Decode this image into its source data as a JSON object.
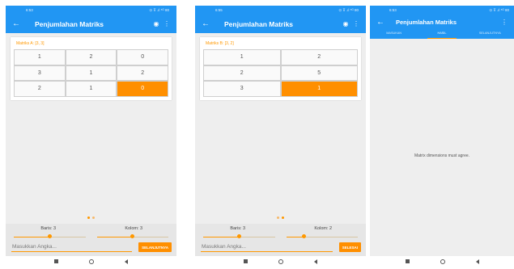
{
  "status_bar": {
    "time": "6:53",
    "time_b": "6:55",
    "time_c": "6:53",
    "right": "⊙ ⊽ .ıl ⁵ᴳ 80"
  },
  "app_title": "Penjumlahan Matriks",
  "screen_a": {
    "card_title": "Matriks A: [3, 3]",
    "rows": [
      [
        "1",
        "2",
        "0"
      ],
      [
        "3",
        "1",
        "2"
      ],
      [
        "2",
        "1",
        "0"
      ]
    ],
    "selected": [
      2,
      2
    ],
    "labels": {
      "rows": "Baris: 3",
      "cols": "Kolom: 3"
    },
    "rows_level": 0.5,
    "cols_level": 0.5,
    "input_placeholder": "Masukkan Angka...",
    "button": "SELANJUTNYA"
  },
  "screen_b": {
    "card_title": "Matriks B: [3, 2]",
    "rows": [
      [
        "1",
        "2"
      ],
      [
        "2",
        "5"
      ],
      [
        "3",
        "1"
      ]
    ],
    "selected": [
      2,
      1
    ],
    "labels": {
      "rows": "Baris: 3",
      "cols": "Kolom: 2"
    },
    "rows_level": 0.5,
    "cols_level": 0.25,
    "input_placeholder": "Masukkan Angka...",
    "button": "SELESAI"
  },
  "screen_c": {
    "tabs": [
      "MASUKAN",
      "HASIL",
      "SELANJUTNYA"
    ],
    "active_tab": 1,
    "message": "Matrix dimensions must agree."
  },
  "colors": {
    "primary": "#2196f3",
    "accent": "#ff9800"
  },
  "icons": {
    "back": "arrow-left-icon",
    "more": "more-vert-icon",
    "eye": "eye-icon"
  }
}
